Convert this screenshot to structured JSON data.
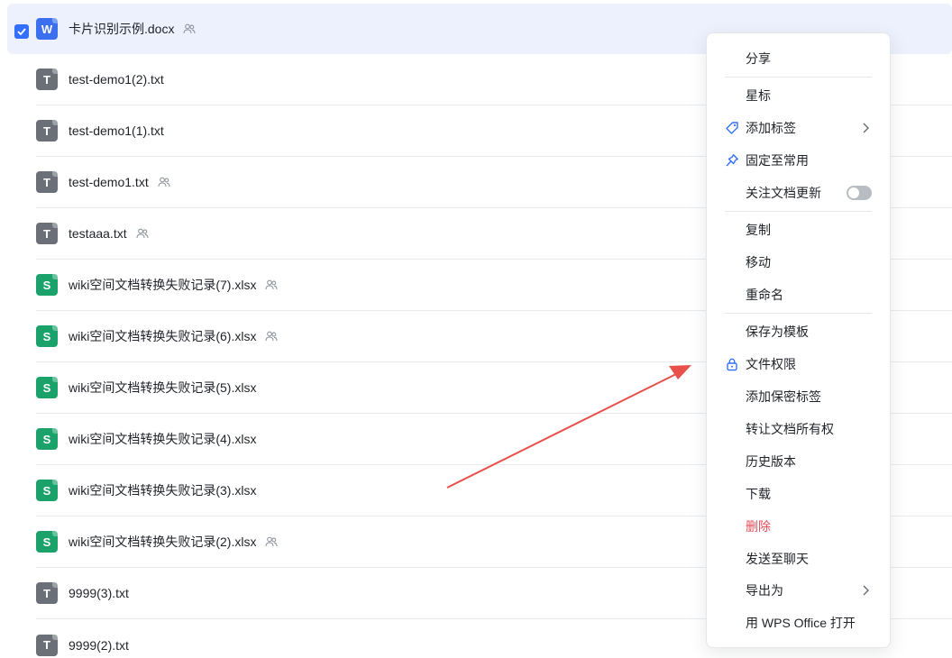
{
  "files": [
    {
      "name": "卡片识别示例.docx",
      "type": "word",
      "icon_letter": "W",
      "shared": true,
      "selected": true
    },
    {
      "name": "test-demo1(2).txt",
      "type": "txt",
      "icon_letter": "T",
      "shared": false
    },
    {
      "name": "test-demo1(1).txt",
      "type": "txt",
      "icon_letter": "T",
      "shared": false
    },
    {
      "name": "test-demo1.txt",
      "type": "txt",
      "icon_letter": "T",
      "shared": true
    },
    {
      "name": "testaaa.txt",
      "type": "txt",
      "icon_letter": "T",
      "shared": true
    },
    {
      "name": "wiki空间文档转换失败记录(7).xlsx",
      "type": "sheet",
      "icon_letter": "S",
      "shared": true
    },
    {
      "name": "wiki空间文档转换失败记录(6).xlsx",
      "type": "sheet",
      "icon_letter": "S",
      "shared": true
    },
    {
      "name": "wiki空间文档转换失败记录(5).xlsx",
      "type": "sheet",
      "icon_letter": "S",
      "shared": false
    },
    {
      "name": "wiki空间文档转换失败记录(4).xlsx",
      "type": "sheet",
      "icon_letter": "S",
      "shared": false
    },
    {
      "name": "wiki空间文档转换失败记录(3).xlsx",
      "type": "sheet",
      "icon_letter": "S",
      "shared": false
    },
    {
      "name": "wiki空间文档转换失败记录(2).xlsx",
      "type": "sheet",
      "icon_letter": "S",
      "shared": true
    },
    {
      "name": "9999(3).txt",
      "type": "txt",
      "icon_letter": "T",
      "shared": false
    },
    {
      "name": "9999(2).txt",
      "type": "txt",
      "icon_letter": "T",
      "shared": false
    }
  ],
  "context_menu": {
    "share": "分享",
    "star": "星标",
    "add_tag": "添加标签",
    "pin": "固定至常用",
    "follow_updates": "关注文档更新",
    "follow_updates_on": false,
    "copy": "复制",
    "move": "移动",
    "rename": "重命名",
    "save_as_template": "保存为模板",
    "file_permission": "文件权限",
    "add_secret_tag": "添加保密标签",
    "transfer_ownership": "转让文档所有权",
    "history": "历史版本",
    "download": "下载",
    "delete": "删除",
    "send_to_chat": "发送至聊天",
    "export_as": "导出为",
    "open_with_wps": "用 WPS Office 打开"
  },
  "colors": {
    "accent": "#3370ff",
    "selected_row_bg": "#edf0fd",
    "danger": "#e34d59",
    "word_icon": "#3b6ff0",
    "txt_icon": "#6b7078",
    "sheet_icon": "#1aa26a",
    "annotation_arrow": "#e8514b"
  }
}
